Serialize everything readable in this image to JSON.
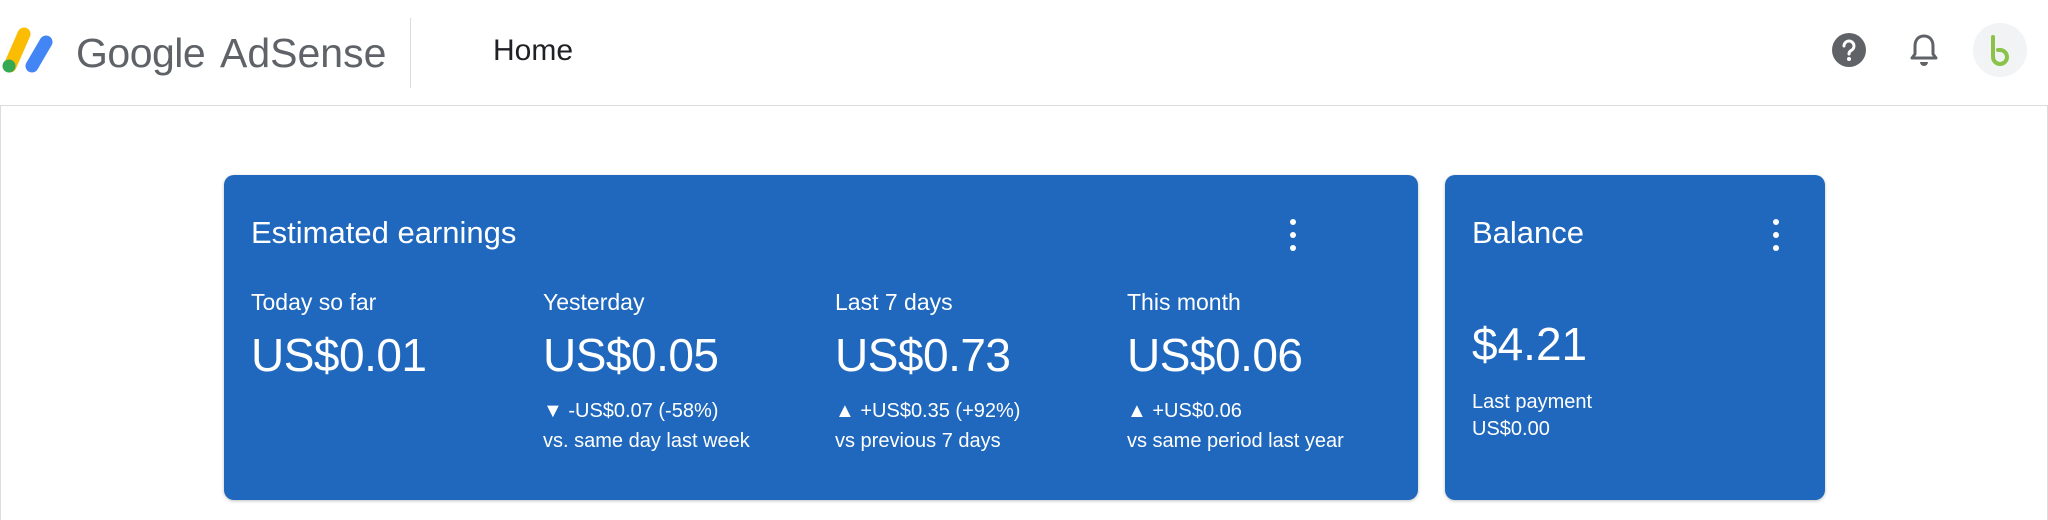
{
  "header": {
    "brand_google": "Google",
    "brand_adsense": "AdSense",
    "page_title": "Home",
    "icons": [
      "help-icon",
      "notifications-bell-icon",
      "account-avatar-icon"
    ],
    "logo_colors": [
      "#fbbc04",
      "#4285f4",
      "#34a853"
    ],
    "avatar_color": "#8bc34a"
  },
  "earnings": {
    "title": "Estimated earnings",
    "metrics": [
      {
        "label": "Today so far",
        "value": "US$0.01",
        "change": "",
        "compare": ""
      },
      {
        "label": "Yesterday",
        "value": "US$0.05",
        "change": "▼ -US$0.07 (-58%)",
        "compare": "vs. same day last week"
      },
      {
        "label": "Last 7 days",
        "value": "US$0.73",
        "change": "▲ +US$0.35 (+92%)",
        "compare": "vs previous 7 days"
      },
      {
        "label": "This month",
        "value": "US$0.06",
        "change": "▲ +US$0.06",
        "compare": "vs same period last year"
      }
    ]
  },
  "balance": {
    "title": "Balance",
    "amount": "$4.21",
    "last_payment_label": "Last payment",
    "last_payment_value": "US$0.00"
  },
  "colors": {
    "card_blue": "#1f68bd",
    "text_on_card": "#ffffff"
  }
}
